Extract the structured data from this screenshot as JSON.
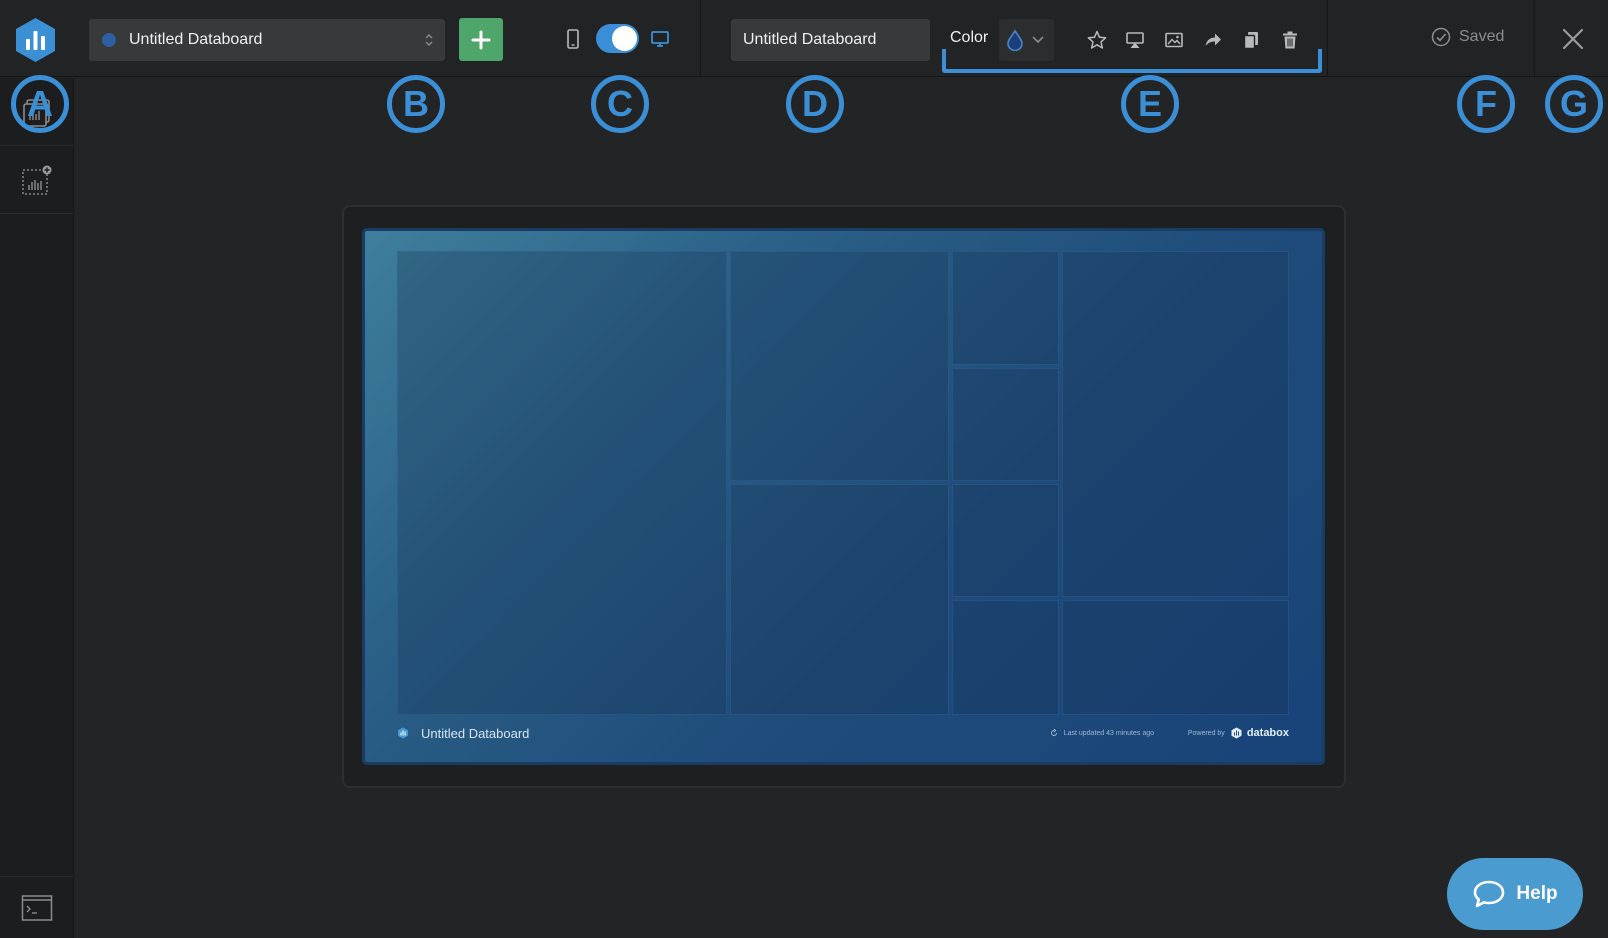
{
  "header": {
    "databoard_selector": {
      "name": "Untitled Databoard"
    },
    "title_input": {
      "value": "Untitled Databoard"
    },
    "color_label": "Color",
    "saved_label": "Saved"
  },
  "callouts": [
    "A",
    "B",
    "C",
    "D",
    "E",
    "F",
    "G"
  ],
  "board": {
    "name": "Untitled Databoard",
    "last_updated": "Last updated 43 minutes ago",
    "powered_by": "Powered by",
    "brand": "databox"
  },
  "help_button": {
    "label": "Help"
  },
  "icons": {
    "logo": "databox-logo-icon",
    "add": "plus-icon",
    "mobile": "mobile-device-icon",
    "desktop": "desktop-device-icon",
    "color": "droplet-icon",
    "toolbar": [
      "star-icon",
      "airplay-icon",
      "image-icon",
      "share-icon",
      "copy-icon",
      "trash-icon"
    ],
    "saved": "check-circle-icon",
    "close": "close-icon",
    "sidebar": [
      "datablocks-icon",
      "add-datablock-icon",
      "terminal-icon"
    ]
  },
  "colors": {
    "accent": "#3a8fd6",
    "add_button": "#4ea66a",
    "help_button": "#4a9bd0",
    "board_dot": "#2e5fa3"
  }
}
